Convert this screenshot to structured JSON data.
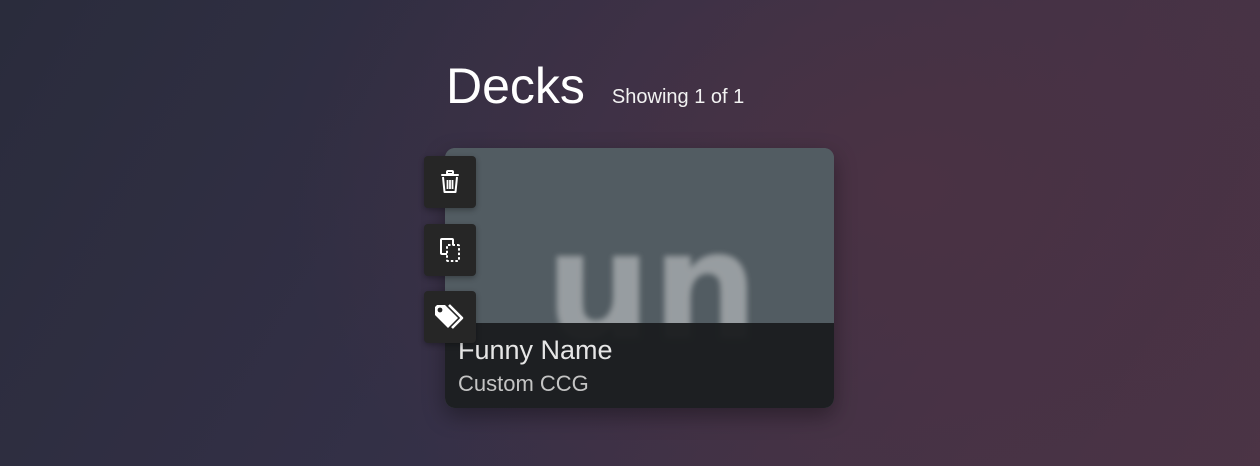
{
  "header": {
    "title": "Decks",
    "count": "Showing 1 of 1"
  },
  "decks": [
    {
      "name": "Funny Name",
      "type": "Custom CCG",
      "image_letters": "un"
    }
  ],
  "actions": [
    {
      "name": "delete",
      "icon": "trash-icon"
    },
    {
      "name": "copy",
      "icon": "copy-icon"
    },
    {
      "name": "tags",
      "icon": "tags-icon"
    }
  ],
  "colors": {
    "card_image_bg": "#525c62",
    "card_footer_bg": "#1b1d1f",
    "action_bg": "#262626"
  }
}
